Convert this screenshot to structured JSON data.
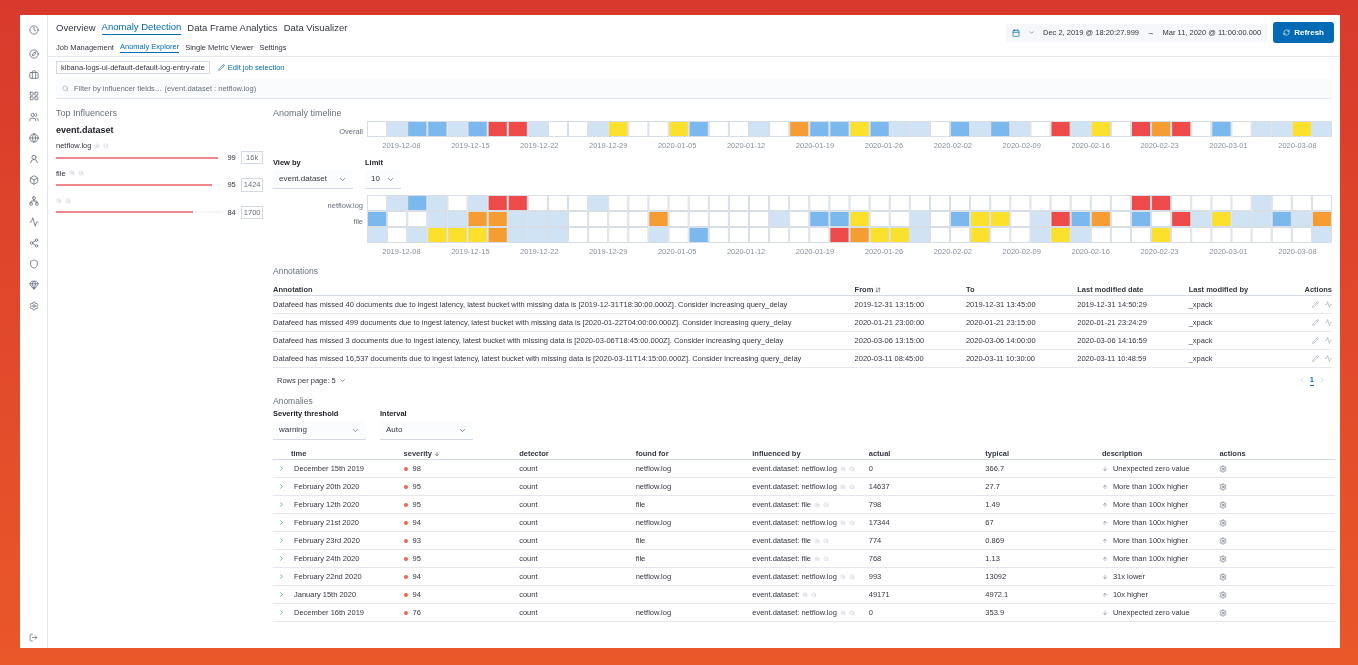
{
  "nav_tabs": [
    {
      "label": "Overview",
      "selected": false
    },
    {
      "label": "Anomaly Detection",
      "selected": true
    },
    {
      "label": "Data Frame Analytics",
      "selected": false
    },
    {
      "label": "Data Visualizer",
      "selected": false
    }
  ],
  "sub_tabs": [
    {
      "label": "Job Management",
      "selected": false
    },
    {
      "label": "Anomaly Explorer",
      "selected": true
    },
    {
      "label": "Single Metric Viewer",
      "selected": false
    },
    {
      "label": "Settings",
      "selected": false
    }
  ],
  "time_range": {
    "start": "Dec 2, 2019 @ 18:20:27.999",
    "arrow": "→",
    "end": "Mar 11, 2020 @ 11:00:00.000",
    "refresh": "Refresh"
  },
  "job_badge": "kibana-logs-ui-default-default-log-entry-rate",
  "edit_job": "Edit job selection",
  "filter": {
    "placeholder": "Filter by influencer fields… (event.dataset : netflow.log)"
  },
  "influencers": {
    "title": "Top Influencers",
    "field": "event.dataset",
    "items": [
      {
        "name": "netflow.log",
        "score": "99",
        "count": "16k",
        "level": 0.97
      },
      {
        "name": "file",
        "score": "95",
        "count": "1424",
        "level": 0.93
      },
      {
        "score": "84",
        "count": "1700",
        "level": 0.82
      }
    ]
  },
  "timeline": {
    "title": "Anomaly timeline",
    "overall": {
      "label": "Overall",
      "cells": [
        {
          "color": "#ffffff"
        },
        {
          "color": "#cfe3f5"
        },
        {
          "color": "#7ab8ee"
        },
        {
          "color": "#7ab8ee"
        },
        {
          "color": "#cfe3f5"
        },
        {
          "color": "#7ab8ee"
        },
        {
          "color": "#ef4a4a"
        },
        {
          "color": "#ef4a4a"
        },
        {
          "color": "#cfe3f5"
        },
        {
          "color": "#ffffff"
        },
        {
          "color": "#ffffff"
        },
        {
          "color": "#cfe3f5"
        },
        {
          "color": "#fbe02c"
        },
        {
          "color": "#ffffff"
        },
        {
          "color": "#ffffff"
        },
        {
          "color": "#fbe02c"
        },
        {
          "color": "#7ab8ee"
        },
        {
          "color": "#ffffff"
        },
        {
          "color": "#ffffff"
        },
        {
          "color": "#cfe3f5"
        },
        {
          "color": "#ffffff"
        },
        {
          "color": "#f59d32"
        },
        {
          "color": "#7ab8ee"
        },
        {
          "color": "#7ab8ee"
        },
        {
          "color": "#fbe02c"
        },
        {
          "color": "#7ab8ee"
        },
        {
          "color": "#cfe3f5"
        },
        {
          "color": "#cfe3f5"
        },
        {
          "color": "#ffffff"
        },
        {
          "color": "#7ab8ee"
        },
        {
          "color": "#cfe3f5"
        },
        {
          "color": "#7ab8ee"
        },
        {
          "color": "#cfe3f5"
        },
        {
          "color": "#ffffff"
        },
        {
          "color": "#ef4a4a"
        },
        {
          "color": "#cfe3f5"
        },
        {
          "color": "#fbe02c"
        },
        {
          "color": "#ffffff"
        },
        {
          "color": "#ef4a4a"
        },
        {
          "color": "#f59d32"
        },
        {
          "color": "#ef4a4a"
        },
        {
          "color": "#ffffff"
        },
        {
          "color": "#7ab8ee"
        },
        {
          "color": "#ffffff"
        },
        {
          "color": "#cfe3f5"
        },
        {
          "color": "#cfe3f5"
        },
        {
          "color": "#fbe02c"
        },
        {
          "color": "#cfe3f5"
        }
      ]
    },
    "overall_ticks": [
      "2019-12-08",
      "2019-12-15",
      "2019-12-22",
      "2019-12-29",
      "2020-01-05",
      "2020-01-12",
      "2020-01-19",
      "2020-01-26",
      "2020-02-02",
      "2020-02-09",
      "2020-02-16",
      "2020-02-23",
      "2020-03-01",
      "2020-03-08"
    ],
    "view_by": {
      "label": "View by",
      "value": "event.dataset"
    },
    "limit": {
      "label": "Limit",
      "value": "10"
    },
    "lanes": [
      {
        "label": "netflow.log",
        "cells": [
          {
            "color": "#ffffff"
          },
          {
            "color": "#cfe3f5"
          },
          {
            "color": "#7ab8ee"
          },
          {
            "color": "#cfe3f5"
          },
          {
            "color": "#ffffff"
          },
          {
            "color": "#cfe3f5"
          },
          {
            "color": "#ef4a4a"
          },
          {
            "color": "#ef4a4a"
          },
          {
            "color": "#ffffff"
          },
          {
            "color": "#ffffff"
          },
          {
            "color": "#ffffff"
          },
          {
            "color": "#cfe3f5"
          },
          {
            "color": "#ffffff"
          },
          {
            "color": "#ffffff"
          },
          {
            "color": "#ffffff"
          },
          {
            "color": "#ffffff"
          },
          {
            "color": "#ffffff"
          },
          {
            "color": "#ffffff"
          },
          {
            "color": "#ffffff"
          },
          {
            "color": "#ffffff"
          },
          {
            "color": "#ffffff"
          },
          {
            "color": "#ffffff"
          },
          {
            "color": "#ffffff"
          },
          {
            "color": "#ffffff"
          },
          {
            "color": "#ffffff"
          },
          {
            "color": "#ffffff"
          },
          {
            "color": "#ffffff"
          },
          {
            "color": "#ffffff"
          },
          {
            "color": "#ffffff"
          },
          {
            "color": "#ffffff"
          },
          {
            "color": "#ffffff"
          },
          {
            "color": "#ffffff"
          },
          {
            "color": "#ffffff"
          },
          {
            "color": "#ffffff"
          },
          {
            "color": "#ffffff"
          },
          {
            "color": "#ffffff"
          },
          {
            "color": "#ffffff"
          },
          {
            "color": "#ffffff"
          },
          {
            "color": "#ef4a4a"
          },
          {
            "color": "#ef4a4a"
          },
          {
            "color": "#ffffff"
          },
          {
            "color": "#ffffff"
          },
          {
            "color": "#ffffff"
          },
          {
            "color": "#ffffff"
          },
          {
            "color": "#cfe3f5"
          },
          {
            "color": "#ffffff"
          },
          {
            "color": "#ffffff"
          },
          {
            "color": "#ffffff"
          }
        ]
      },
      {
        "label": "file",
        "cells": [
          {
            "color": "#7ab8ee"
          },
          {
            "color": "#ffffff"
          },
          {
            "color": "#ffffff"
          },
          {
            "color": "#cfe3f5"
          },
          {
            "color": "#cfe3f5"
          },
          {
            "color": "#f59d32"
          },
          {
            "color": "#f59d32"
          },
          {
            "color": "#cfe3f5"
          },
          {
            "color": "#cfe3f5"
          },
          {
            "color": "#cfe3f5"
          },
          {
            "color": "#ffffff"
          },
          {
            "color": "#ffffff"
          },
          {
            "color": "#ffffff"
          },
          {
            "color": "#ffffff"
          },
          {
            "color": "#f59d32"
          },
          {
            "color": "#ffffff"
          },
          {
            "color": "#ffffff"
          },
          {
            "color": "#ffffff"
          },
          {
            "color": "#ffffff"
          },
          {
            "color": "#ffffff"
          },
          {
            "color": "#cfe3f5"
          },
          {
            "color": "#ffffff"
          },
          {
            "color": "#7ab8ee"
          },
          {
            "color": "#7ab8ee"
          },
          {
            "color": "#fbe02c"
          },
          {
            "color": "#ffffff"
          },
          {
            "color": "#ffffff"
          },
          {
            "color": "#cfe3f5"
          },
          {
            "color": "#ffffff"
          },
          {
            "color": "#7ab8ee"
          },
          {
            "color": "#fbe02c"
          },
          {
            "color": "#fbe02c"
          },
          {
            "color": "#ffffff"
          },
          {
            "color": "#cfe3f5"
          },
          {
            "color": "#ef4a4a"
          },
          {
            "color": "#7ab8ee"
          },
          {
            "color": "#f59d32"
          },
          {
            "color": "#ffffff"
          },
          {
            "color": "#7ab8ee"
          },
          {
            "color": "#ffffff"
          },
          {
            "color": "#ef4a4a"
          },
          {
            "color": "#cfe3f5"
          },
          {
            "color": "#fbe02c"
          },
          {
            "color": "#cfe3f5"
          },
          {
            "color": "#cfe3f5"
          },
          {
            "color": "#7ab8ee"
          },
          {
            "color": "#cfe3f5"
          },
          {
            "color": "#f59d32"
          }
        ]
      },
      {
        "cells": [
          {
            "color": "#cfe3f5"
          },
          {
            "color": "#ffffff"
          },
          {
            "color": "#cfe3f5"
          },
          {
            "color": "#fbe02c"
          },
          {
            "color": "#fbe02c"
          },
          {
            "color": "#fbe02c"
          },
          {
            "color": "#f59d32"
          },
          {
            "color": "#cfe3f5"
          },
          {
            "color": "#cfe3f5"
          },
          {
            "color": "#cfe3f5"
          },
          {
            "color": "#ffffff"
          },
          {
            "color": "#ffffff"
          },
          {
            "color": "#ffffff"
          },
          {
            "color": "#ffffff"
          },
          {
            "color": "#cfe3f5"
          },
          {
            "color": "#ffffff"
          },
          {
            "color": "#7ab8ee"
          },
          {
            "color": "#ffffff"
          },
          {
            "color": "#ffffff"
          },
          {
            "color": "#ffffff"
          },
          {
            "color": "#ffffff"
          },
          {
            "color": "#ffffff"
          },
          {
            "color": "#ffffff"
          },
          {
            "color": "#ef4a4a"
          },
          {
            "color": "#f59d32"
          },
          {
            "color": "#fbe02c"
          },
          {
            "color": "#fbe02c"
          },
          {
            "color": "#cfe3f5"
          },
          {
            "color": "#ffffff"
          },
          {
            "color": "#ffffff"
          },
          {
            "color": "#fbe02c"
          },
          {
            "color": "#ffffff"
          },
          {
            "color": "#ffffff"
          },
          {
            "color": "#cfe3f5"
          },
          {
            "color": "#fbe02c"
          },
          {
            "color": "#cfe3f5"
          },
          {
            "color": "#ffffff"
          },
          {
            "color": "#ffffff"
          },
          {
            "color": "#ffffff"
          },
          {
            "color": "#fbe02c"
          },
          {
            "color": "#ffffff"
          },
          {
            "color": "#ffffff"
          },
          {
            "color": "#ffffff"
          },
          {
            "color": "#ffffff"
          },
          {
            "color": "#ffffff"
          },
          {
            "color": "#ffffff"
          },
          {
            "color": "#ffffff"
          },
          {
            "color": "#cfe3f5"
          }
        ]
      }
    ],
    "lane_ticks": [
      "2019-12-08",
      "2019-12-15",
      "2019-12-22",
      "2019-12-29",
      "2020-01-05",
      "2020-01-12",
      "2020-01-19",
      "2020-01-26",
      "2020-02-02",
      "2020-02-09",
      "2020-02-16",
      "2020-02-23",
      "2020-03-01",
      "2020-03-08"
    ]
  },
  "annotations": {
    "title": "Annotations",
    "columns": [
      "Annotation",
      "From",
      "To",
      "Last modified date",
      "Last modified by",
      "Actions"
    ],
    "rows": [
      {
        "annotation": "Datafeed has missed 40 documents due to ingest latency, latest bucket with missing data is [2019-12-31T18:30:00.000Z]. Consider increasing query_delay",
        "from": "2019-12-31 13:15:00",
        "to": "2019-12-31 13:45:00",
        "modified": "2019-12-31 14:50:29",
        "by": "_xpack"
      },
      {
        "annotation": "Datafeed has missed 499 documents due to ingest latency, latest bucket with missing data is [2020-01-22T04:00:00.000Z]. Consider increasing query_delay",
        "from": "2020-01-21 23:00:00",
        "to": "2020-01-21 23:15:00",
        "modified": "2020-01-21 23:24:29",
        "by": "_xpack"
      },
      {
        "annotation": "Datafeed has missed 3 documents due to ingest latency, latest bucket with missing data is [2020-03-06T18:45:00.000Z]. Consider increasing query_delay",
        "from": "2020-03-06 13:15:00",
        "to": "2020-03-06 14:00:00",
        "modified": "2020-03-06 14:16:59",
        "by": "_xpack"
      },
      {
        "annotation": "Datafeed has missed 16,537 documents due to ingest latency, latest bucket with missing data is [2020-03-11T14:15:00.000Z]. Consider increasing query_delay",
        "from": "2020-03-11 08:45:00",
        "to": "2020-03-11 10:30:00",
        "modified": "2020-03-11 10:48:59",
        "by": "_xpack"
      }
    ],
    "rows_per_page": "Rows per page: 5",
    "page": "1"
  },
  "anomalies": {
    "title": "Anomalies",
    "severity": {
      "label": "Severity threshold",
      "value": "warning"
    },
    "interval": {
      "label": "Interval",
      "value": "Auto"
    },
    "columns": [
      "time",
      "severity",
      "detector",
      "found for",
      "influenced by",
      "actual",
      "typical",
      "description",
      "actions"
    ],
    "rows": [
      {
        "time": "December 15th 2019",
        "severity": "98",
        "detector": "count",
        "found_for": "netflow.log",
        "influenced_by": "event.dataset: netflow.log",
        "actual": "0",
        "typical": "366.7",
        "kind": "down",
        "description": "Unexpected zero value"
      },
      {
        "time": "February 20th 2020",
        "severity": "95",
        "detector": "count",
        "found_for": "netflow.log",
        "influenced_by": "event.dataset: netflow.log",
        "actual": "14637",
        "typical": "27.7",
        "kind": "up",
        "description": "More than 100x higher"
      },
      {
        "time": "February 12th 2020",
        "severity": "95",
        "detector": "count",
        "found_for": "file",
        "influenced_by": "event.dataset: file",
        "actual": "798",
        "typical": "1.49",
        "kind": "up",
        "description": "More than 100x higher"
      },
      {
        "time": "February 21st 2020",
        "severity": "94",
        "detector": "count",
        "found_for": "netflow.log",
        "influenced_by": "event.dataset: netflow.log",
        "actual": "17344",
        "typical": "67",
        "kind": "up",
        "description": "More than 100x higher"
      },
      {
        "time": "February 23rd 2020",
        "severity": "93",
        "detector": "count",
        "found_for": "file",
        "influenced_by": "event.dataset: file",
        "actual": "774",
        "typical": "0.869",
        "kind": "up",
        "description": "More than 100x higher"
      },
      {
        "time": "February 24th 2020",
        "severity": "95",
        "detector": "count",
        "found_for": "file",
        "influenced_by": "event.dataset: file",
        "actual": "768",
        "typical": "1.13",
        "kind": "up",
        "description": "More than 100x higher"
      },
      {
        "time": "February 22nd 2020",
        "severity": "94",
        "detector": "count",
        "found_for": "netflow.log",
        "influenced_by": "event.dataset: netflow.log",
        "actual": "993",
        "typical": "13092",
        "kind": "down",
        "description": "31x lower"
      },
      {
        "time": "January 15th 2020",
        "severity": "94",
        "detector": "count",
        "influenced_by": "event.dataset:",
        "actual": "49171",
        "typical": "4972.1",
        "kind": "up",
        "description": "10x higher"
      },
      {
        "time": "December 16th 2019",
        "severity": "76",
        "detector": "count",
        "found_for": "netflow.log",
        "influenced_by": "event.dataset: netflow.log",
        "actual": "0",
        "typical": "353.9",
        "kind": "down",
        "description": "Unexpected zero value"
      }
    ]
  }
}
